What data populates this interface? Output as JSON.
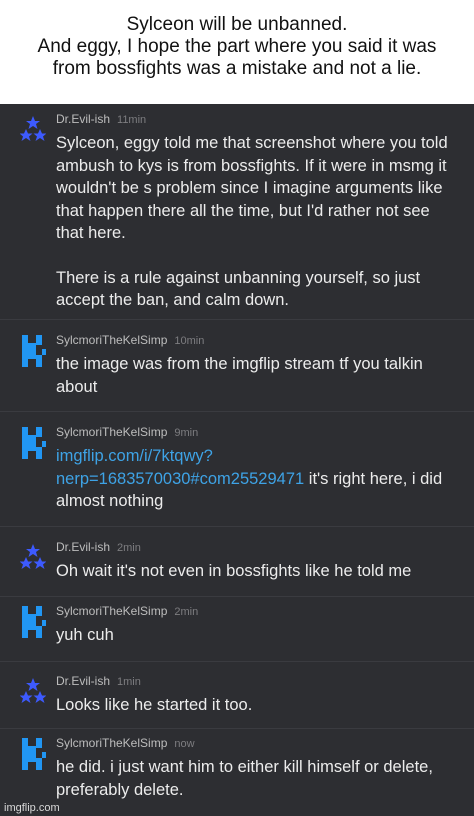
{
  "caption": {
    "line1": "Sylceon will be unbanned.",
    "line2": "And eggy, I hope the part where you said it was",
    "line3": "from bossfights was a mistake and not a lie."
  },
  "comments": [
    {
      "author": "Dr.Evil-ish",
      "time": "11min",
      "avatar": "evil-stars-icon",
      "p1": "Sylceon, eggy told me that screenshot where you told ambush to kys is from bossfights. If it were in msmg it wouldn't be s problem since I imagine arguments like that happen there all the time, but I'd rather not see that here.",
      "p2": "There is a rule against unbanning yourself, so just accept the ban, and calm down."
    },
    {
      "author": "SylcmoriTheKelSimp",
      "time": "10min",
      "avatar": "blue-blocky-icon",
      "text": "the image was from the imgflip stream tf you talkin about"
    },
    {
      "author": "SylcmoriTheKelSimp",
      "time": "9min",
      "avatar": "blue-blocky-icon",
      "link": "imgflip.com/i/7ktqwy?nerp=1683570030#com25529471",
      "text": " it's right here, i did almost nothing"
    },
    {
      "author": "Dr.Evil-ish",
      "time": "2min",
      "avatar": "evil-stars-icon",
      "text": "Oh wait it's not even in bossfights like he told me"
    },
    {
      "author": "SylcmoriTheKelSimp",
      "time": "2min",
      "avatar": "blue-blocky-icon",
      "text": "yuh cuh"
    },
    {
      "author": "Dr.Evil-ish",
      "time": "1min",
      "avatar": "evil-stars-icon",
      "text": "Looks like he started it too."
    },
    {
      "author": "SylcmoriTheKelSimp",
      "time": "now",
      "avatar": "blue-blocky-icon",
      "text": "he did. i just want him to either kill himself or delete, preferably delete."
    }
  ],
  "watermark": "imgflip.com",
  "colors": {
    "background": "#2d2e32",
    "text": "#ececec",
    "link": "#3ea3e6",
    "avatar_blue": "#2196f3",
    "avatar_star": "#3d5afe"
  }
}
